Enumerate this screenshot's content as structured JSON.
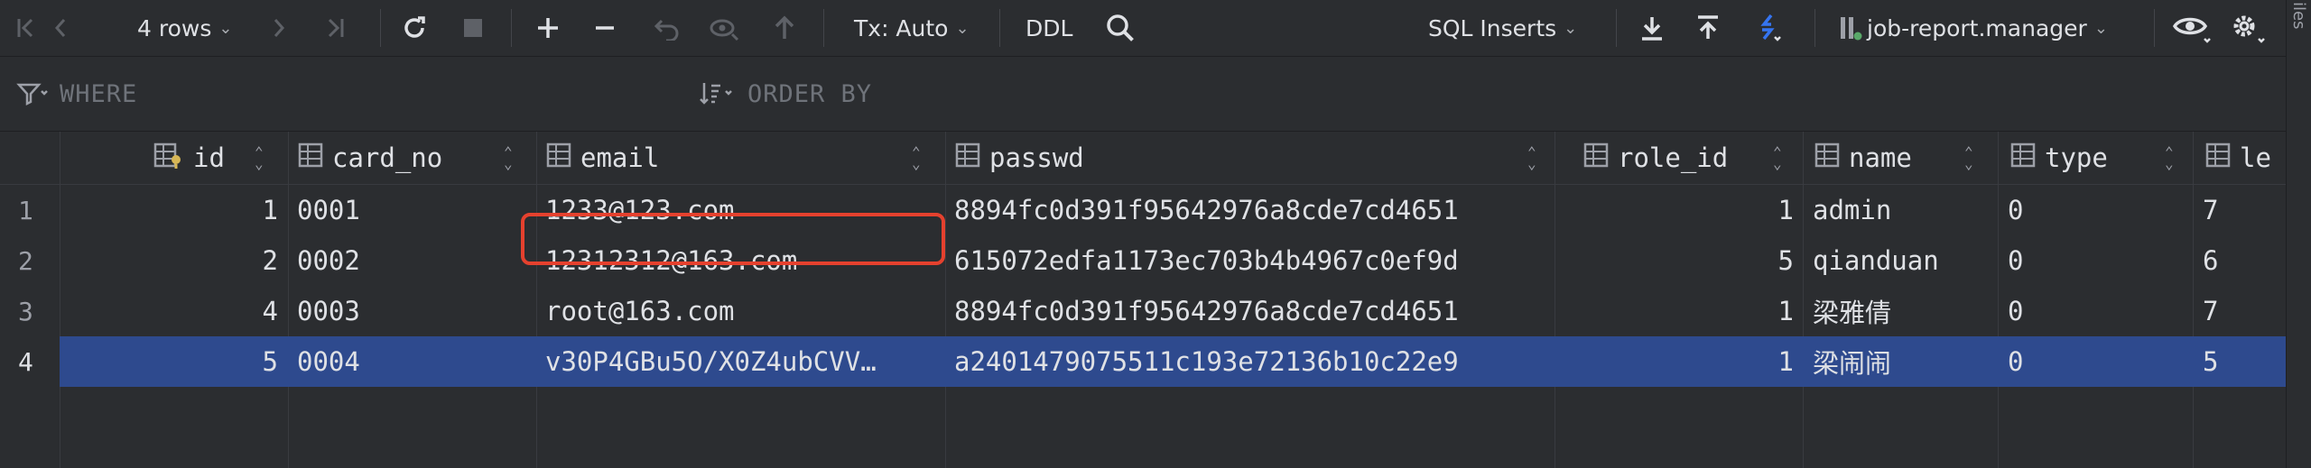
{
  "toolbar": {
    "rows_label": "4 rows",
    "tx_label": "Tx: Auto",
    "ddl_label": "DDL",
    "export_format": "SQL Inserts",
    "datasource": "job-report.manager"
  },
  "filter": {
    "where_label": "WHERE",
    "order_label": "ORDER BY"
  },
  "columns": [
    {
      "name": "id"
    },
    {
      "name": "card_no"
    },
    {
      "name": "email"
    },
    {
      "name": "passwd"
    },
    {
      "name": "role_id"
    },
    {
      "name": "name"
    },
    {
      "name": "type"
    },
    {
      "name": "le"
    }
  ],
  "rows": [
    {
      "num": "1",
      "id": "1",
      "card_no": "0001",
      "email": "1233@123.com",
      "passwd": "8894fc0d391f95642976a8cde7cd4651",
      "role_id": "1",
      "name": "admin",
      "type": "0",
      "le": "7"
    },
    {
      "num": "2",
      "id": "2",
      "card_no": "0002",
      "email": "12312312@163.com",
      "passwd": "615072edfa1173ec703b4b4967c0ef9d",
      "role_id": "5",
      "name": "qianduan",
      "type": "0",
      "le": "6"
    },
    {
      "num": "3",
      "id": "4",
      "card_no": "0003",
      "email": "root@163.com",
      "passwd": "8894fc0d391f95642976a8cde7cd4651",
      "role_id": "1",
      "name": "梁雅倩",
      "type": "0",
      "le": "7"
    },
    {
      "num": "4",
      "id": "5",
      "card_no": "0004",
      "email": "v30P4GBu5O/X0Z4ubCVV…",
      "passwd": "a2401479075511c193e72136b10c22e9",
      "role_id": "1",
      "name": "梁闹闹",
      "type": "0",
      "le": "5"
    }
  ],
  "side_panel_label": "iles",
  "colors": {
    "background": "#2b2d30",
    "selection": "#2e4a8e",
    "highlight": "#e5412e",
    "accent": "#3574f0"
  }
}
